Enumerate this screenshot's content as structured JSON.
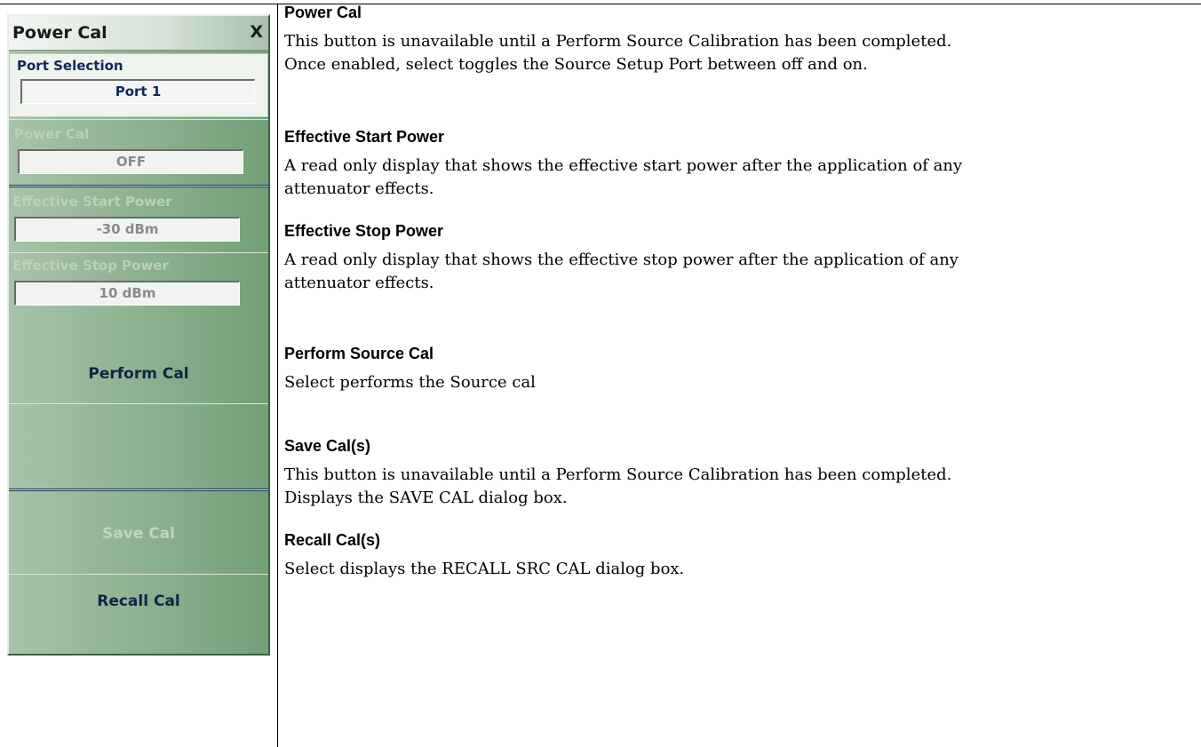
{
  "panel": {
    "title": "Power Cal",
    "close_label": "X",
    "port_selection": {
      "label": "Port Selection",
      "value": "Port 1"
    },
    "power_cal": {
      "label": "Power Cal",
      "value": "OFF"
    },
    "effective_start_power": {
      "label": "Effective Start Power",
      "value": "-30  dBm"
    },
    "effective_stop_power": {
      "label": "Effective Stop Power",
      "value": "10  dBm"
    },
    "perform_cal": "Perform  Cal",
    "save_cal": "Save Cal",
    "recall_cal": "Recall Cal"
  },
  "doc": {
    "sections": [
      {
        "heading": "Power Cal",
        "lines": [
          "This button is unavailable until a Perform Source Calibration has been completed.",
          "Once enabled, select toggles the Source Setup Port between off and on."
        ]
      },
      {
        "heading": "Effective Start Power",
        "lines": [
          "A read only display that shows the effective start power after the application of any",
          "attenuator effects."
        ]
      },
      {
        "heading": "Effective Stop Power",
        "lines": [
          "A read only display that shows the effective stop power after the application of any",
          "attenuator effects."
        ]
      },
      {
        "heading": "Perform Source Cal",
        "lines": [
          "Select performs the Source cal"
        ]
      },
      {
        "heading": "Save Cal(s)",
        "lines": [
          "This button is unavailable until a Perform Source Calibration has been completed.",
          "Displays the SAVE CAL dialog box."
        ]
      },
      {
        "heading": "Recall Cal(s)",
        "lines": [
          "Select displays the RECALL SRC CAL dialog box."
        ]
      }
    ]
  }
}
